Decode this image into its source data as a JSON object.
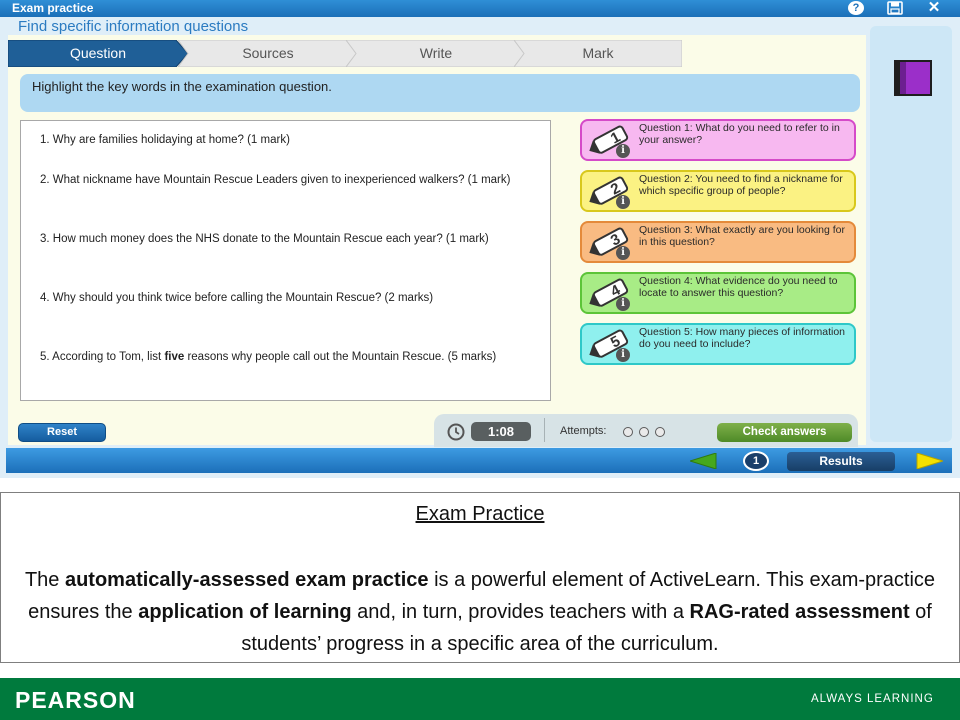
{
  "window": {
    "title": "Exam practice",
    "help_label": "?",
    "close_label": "✕"
  },
  "activity": {
    "subtitle": "Find specific information questions"
  },
  "steps": [
    {
      "label": "Question",
      "active": true
    },
    {
      "label": "Sources",
      "active": false
    },
    {
      "label": "Write",
      "active": false
    },
    {
      "label": "Mark",
      "active": false
    }
  ],
  "instruction": "Highlight the key words in the examination question.",
  "questions": [
    {
      "parts": [
        "1. Why are families holidaying at home? (1 mark)"
      ]
    },
    {
      "parts": [
        "2. What nickname have Mountain Rescue Leaders given to inexperienced walkers? (1 mark)"
      ]
    },
    {
      "parts": [
        "3. How much money does the NHS donate to the Mountain Rescue each year? (1 mark)"
      ]
    },
    {
      "parts": [
        "4. Why should you think twice before calling the Mountain Rescue? (2 marks)"
      ]
    },
    {
      "before": "5. According to Tom, list ",
      "bold": "five",
      "after": " reasons why people call out the Mountain Rescue. (5 marks)"
    }
  ],
  "hints": [
    {
      "number": "1",
      "text": "Question 1: What do you need to refer to in your answer?",
      "bg": "#f7b8f0",
      "border": "#d54ac8"
    },
    {
      "number": "2",
      "text": "Question 2: You need to find a nickname for which specific group of people?",
      "bg": "#fbf283",
      "border": "#d8c81c"
    },
    {
      "number": "3",
      "text": "Question 3: What exactly are you looking for in this question?",
      "bg": "#f9bb82",
      "border": "#e48a3a"
    },
    {
      "number": "4",
      "text": "Question 4: What evidence do you need to locate to answer this question?",
      "bg": "#a8ec86",
      "border": "#5cc438"
    },
    {
      "number": "5",
      "text": "Question 5: How many pieces of information do you need to include?",
      "bg": "#8ff0ee",
      "border": "#2ec8c8"
    }
  ],
  "hint_info_label": "i",
  "controls": {
    "reset_label": "Reset",
    "timer": "1:08",
    "attempts_label": "Attempts:",
    "attempts_total": 3,
    "check_label": "Check answers"
  },
  "navigation": {
    "page_number": "1",
    "results_label": "Results"
  },
  "caption": {
    "title": "Exam Practice",
    "body": [
      {
        "text": "The ",
        "bold": false
      },
      {
        "text": "automatically-assessed exam practice",
        "bold": true
      },
      {
        "text": " is a powerful element of ActiveLearn. This exam-practice ensures the ",
        "bold": false
      },
      {
        "text": "application of learning",
        "bold": true
      },
      {
        "text": " and, in turn, provides teachers with a ",
        "bold": false
      },
      {
        "text": "RAG-rated assessment",
        "bold": true
      },
      {
        "text": " of students’ progress in a specific area of the curriculum.",
        "bold": false
      }
    ]
  },
  "footer": {
    "brand": "PEARSON",
    "tagline": "ALWAYS LEARNING"
  },
  "colors": {
    "title_bar": "#1b6fb8",
    "step_active": "#1f5f97",
    "step_inactive": "#e8e8e8",
    "footer_green": "#007a3d",
    "nav_arrow_green": "#46a81e",
    "nav_arrow_yellow": "#f4e000"
  }
}
